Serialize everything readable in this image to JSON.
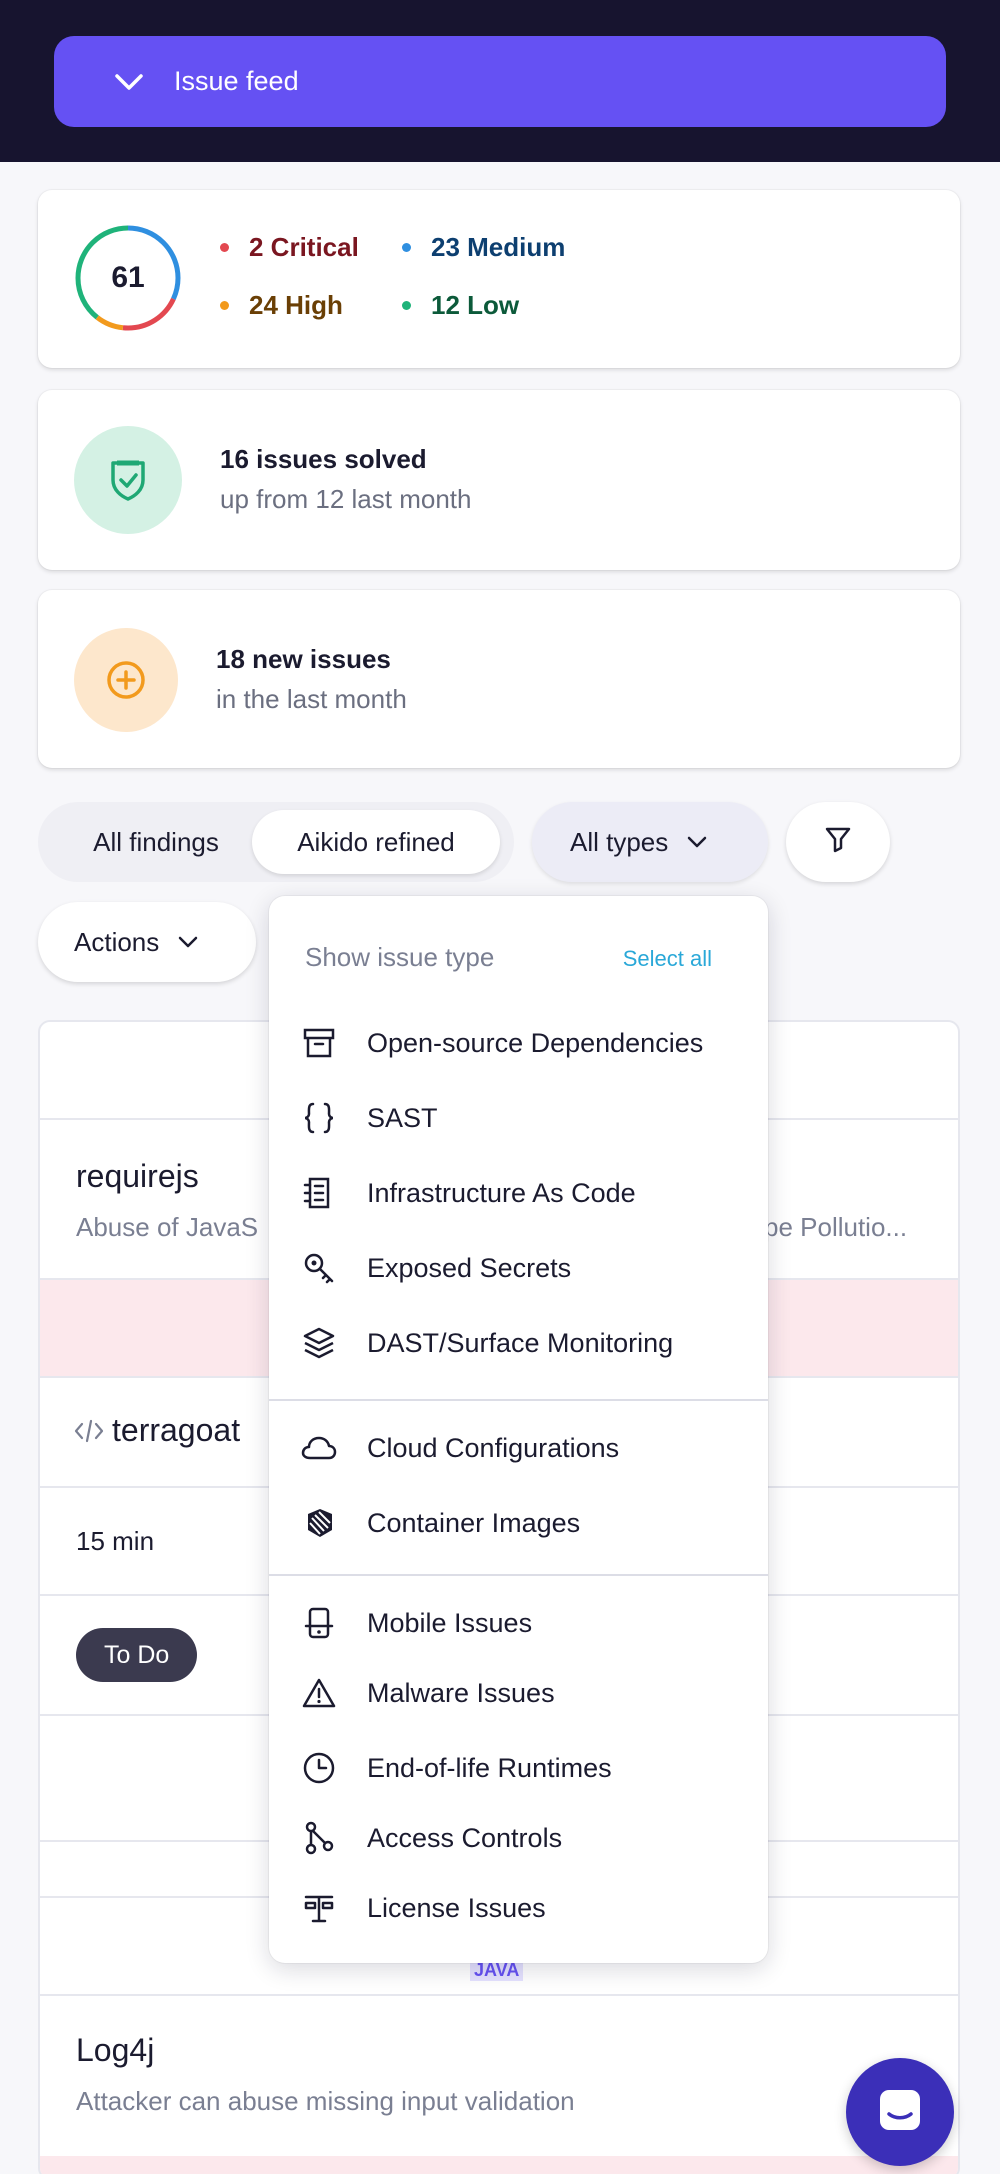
{
  "header": {
    "feed_label": "Issue feed"
  },
  "score": {
    "value": "61",
    "severities": [
      {
        "label": "2 Critical",
        "color": "#e34850",
        "text_color": "#7a1620"
      },
      {
        "label": "23 Medium",
        "color": "#2f8fe0",
        "text_color": "#0d3f70"
      },
      {
        "label": "24 High",
        "color": "#f29a1d",
        "text_color": "#6a3f05"
      },
      {
        "label": "12 Low",
        "color": "#1fb37a",
        "text_color": "#0c5a3a"
      }
    ]
  },
  "solved": {
    "title": "16 issues solved",
    "subtitle": "up from 12 last month"
  },
  "new_issues": {
    "title": "18 new issues",
    "subtitle": "in the last month"
  },
  "filters": {
    "segments": [
      "All findings",
      "Aikido refined"
    ],
    "active_segment": "Aikido refined",
    "types_label": "All types",
    "actions_label": "Actions"
  },
  "table": {
    "rows": [
      {
        "package": "requirejs",
        "description_left": "Abuse of JavaS",
        "description_right": "pe Pollutio..."
      },
      {
        "repo": "terragoat",
        "time": "15 min",
        "status": "To Do",
        "language_tag": "JAVA"
      },
      {
        "package": "Log4j",
        "description": "Attacker can abuse missing input validation"
      }
    ]
  },
  "dropdown": {
    "heading": "Show issue type",
    "select_all": "Select all",
    "groups": [
      [
        {
          "label": "Open-source Dependencies",
          "icon": "archive-box-icon"
        },
        {
          "label": "SAST",
          "icon": "curly-braces-icon"
        },
        {
          "label": "Infrastructure As Code",
          "icon": "server-doc-icon"
        },
        {
          "label": "Exposed Secrets",
          "icon": "key-icon"
        },
        {
          "label": "DAST/Surface Monitoring",
          "icon": "layers-icon"
        }
      ],
      [
        {
          "label": "Cloud Configurations",
          "icon": "cloud-icon"
        },
        {
          "label": "Container Images",
          "icon": "container-icon"
        }
      ],
      [
        {
          "label": "Mobile Issues",
          "icon": "mobile-icon"
        },
        {
          "label": "Malware Issues",
          "icon": "warning-triangle-icon"
        },
        {
          "label": "End-of-life Runtimes",
          "icon": "clock-icon"
        },
        {
          "label": "Access Controls",
          "icon": "graph-nodes-icon"
        },
        {
          "label": "License Issues",
          "icon": "scales-icon"
        }
      ]
    ]
  },
  "colors": {
    "accent": "#6551f3",
    "header_bg": "#17142f",
    "chat": "#3b2fb8"
  }
}
